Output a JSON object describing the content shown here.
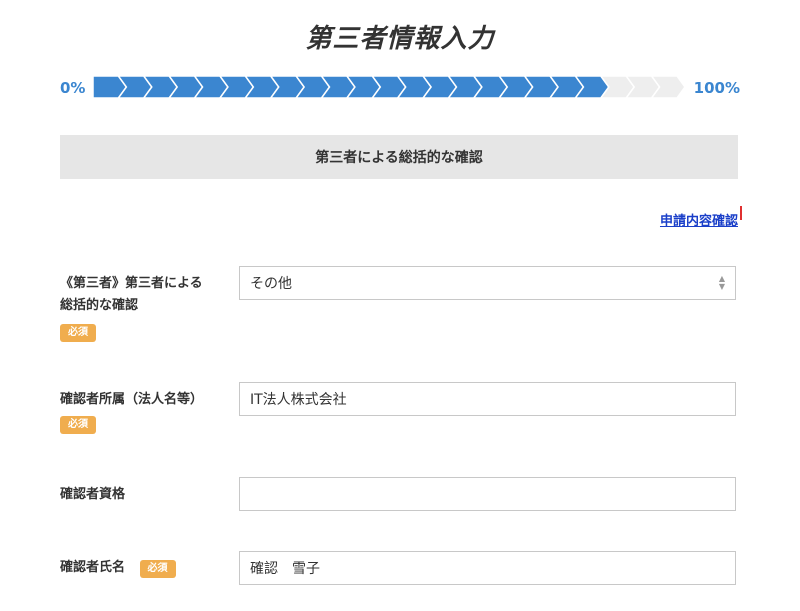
{
  "page": {
    "title": "第三者情報入力"
  },
  "progress": {
    "min_label": "0%",
    "max_label": "100%",
    "fraction": 0.87,
    "total_steps": 23,
    "colors": {
      "filled": "#3b86d0",
      "empty": "#eeeeee"
    }
  },
  "section": {
    "heading": "第三者による総括的な確認"
  },
  "links": {
    "review": "申請内容確認"
  },
  "form": {
    "required_label": "必須",
    "fields": [
      {
        "label_line1": "《第三者》第三者による",
        "label_line2": "総括的な確認",
        "value": "その他",
        "required": true,
        "type": "select"
      },
      {
        "label": "確認者所属（法人名等）",
        "value": "IT法人株式会社",
        "required": true,
        "type": "text"
      },
      {
        "label": "確認者資格",
        "value": "",
        "required": false,
        "type": "text"
      },
      {
        "label": "確認者氏名",
        "value": "確認　雪子",
        "required": true,
        "type": "text"
      }
    ]
  },
  "colors": {
    "accent": "#3b86d0",
    "required_badge": "#f0ad4e",
    "link": "#1a3fc9"
  }
}
